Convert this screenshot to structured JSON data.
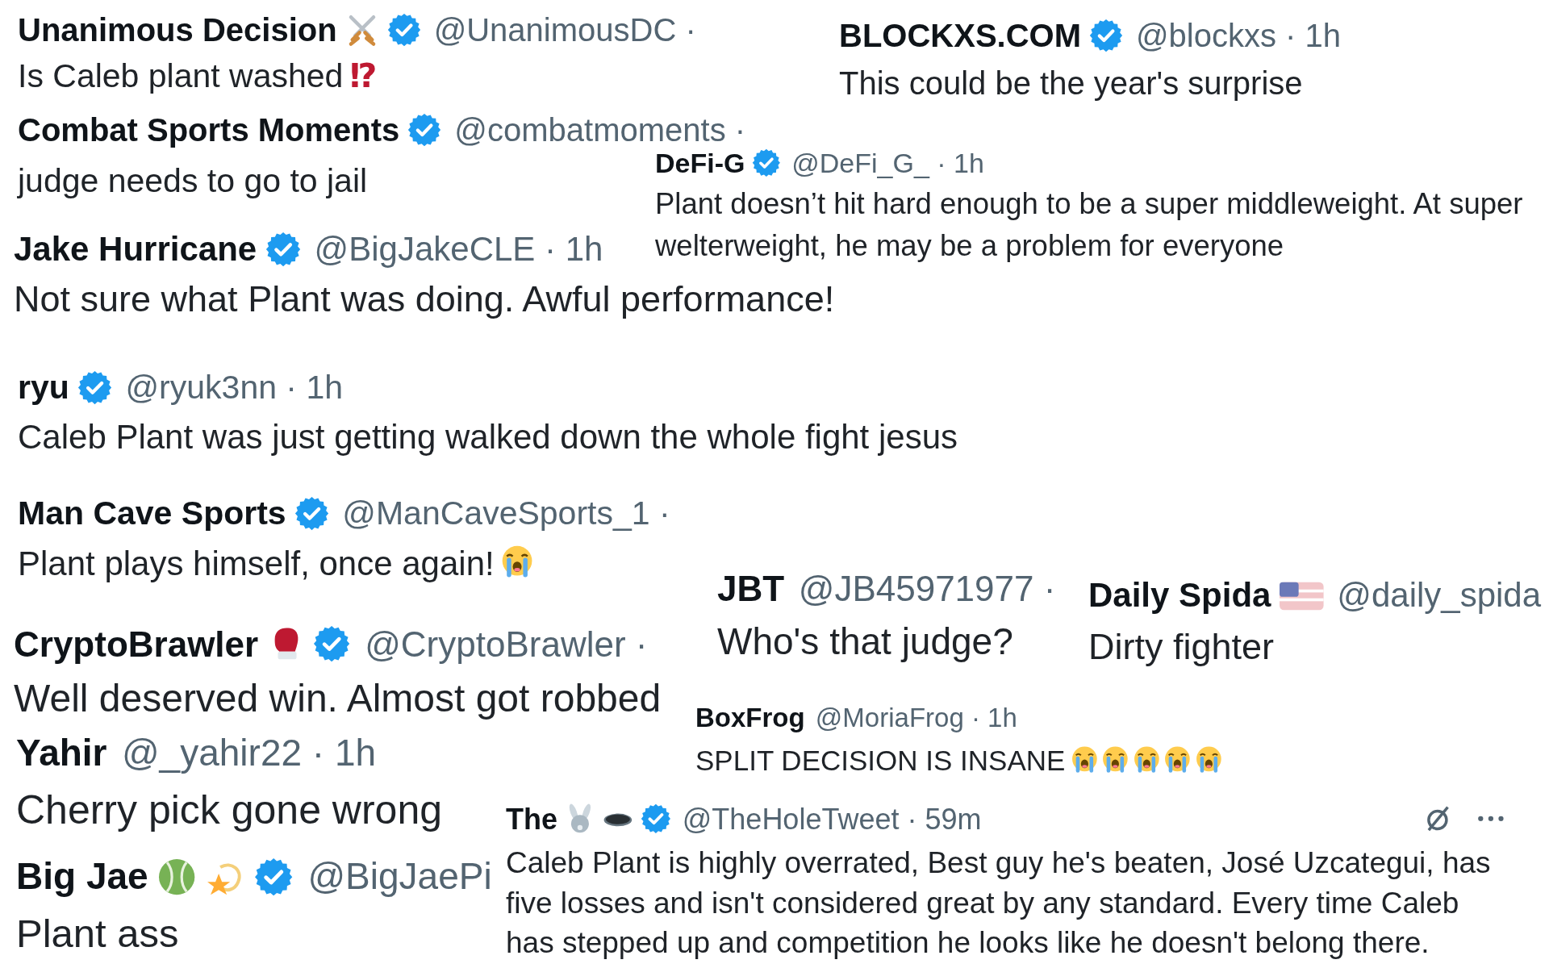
{
  "tweets": [
    {
      "name": "Unanimous Decision",
      "name_icons": [
        {
          "kind": "swords"
        }
      ],
      "verified": true,
      "meta": "@UnanimousDC ·",
      "text": "Is Caleb plant washed",
      "text_mark": "⁉"
    },
    {
      "name": "BLOCKXS.COM",
      "verified": true,
      "meta": "@blockxs · 1h",
      "text": "This could be the year's surprise"
    },
    {
      "name": "Combat Sports Moments",
      "verified": true,
      "meta": "@combatmoments ·",
      "text": "judge needs to go to jail"
    },
    {
      "name": "DeFi-G",
      "verified": true,
      "meta": "@DeFi_G_ · 1h",
      "text": "Plant doesn’t hit hard enough to be a super middleweight. At super welterweight, he may be a problem for everyone"
    },
    {
      "name": "Jake Hurricane",
      "verified": true,
      "meta": "@BigJakeCLE · 1h",
      "text": "Not sure what Plant was doing. Awful performance!"
    },
    {
      "name": "ryu",
      "verified": true,
      "meta": "@ryuk3nn · 1h",
      "text": "Caleb Plant was just getting walked down the whole fight jesus"
    },
    {
      "name": "Man Cave Sports",
      "verified": true,
      "meta": "@ManCaveSports_1 ·",
      "text": "Plant plays himself, once again!",
      "text_icons": [
        {
          "kind": "crying"
        }
      ]
    },
    {
      "name": "CryptoBrawler",
      "name_icons": [
        {
          "kind": "glove"
        }
      ],
      "verified": true,
      "meta": "@CryptoBrawler ·",
      "text": "Well deserved win. Almost got robbed"
    },
    {
      "name": "Yahir",
      "verified": false,
      "meta": "@_yahir22 · 1h",
      "text": "Cherry pick gone wrong"
    },
    {
      "name": "Big Jae",
      "name_icons": [
        {
          "kind": "ball"
        },
        {
          "kind": "star"
        }
      ],
      "verified": true,
      "meta": "@BigJaePi",
      "text": "Plant ass"
    },
    {
      "name": "JBT",
      "verified": false,
      "meta": "@JB45971977 ·",
      "text": "Who's that judge?"
    },
    {
      "name": "Daily Spida",
      "name_icons": [
        {
          "kind": "flag"
        }
      ],
      "verified": false,
      "meta": "@daily_spida",
      "text": "Dirty fighter"
    },
    {
      "name": "BoxFrog",
      "verified": false,
      "meta": "@MoriaFrog · 1h",
      "text": "SPLIT DECISION IS INSANE",
      "text_icons": [
        {
          "kind": "crying"
        },
        {
          "kind": "crying"
        },
        {
          "kind": "crying"
        },
        {
          "kind": "crying"
        },
        {
          "kind": "crying"
        }
      ]
    },
    {
      "name": "The",
      "name_icons": [
        {
          "kind": "rabbit"
        },
        {
          "kind": "hole"
        }
      ],
      "verified": true,
      "meta": "@TheHoleTweet · 59m",
      "actions": [
        {
          "kind": "grok"
        },
        {
          "kind": "more"
        }
      ],
      "text": "Caleb Plant is highly overrated, Best guy he's beaten, José Uzcategui, has five losses and isn't considered great by any standard. Every time Caleb has stepped up and competition he looks like he doesn't belong there."
    }
  ]
}
